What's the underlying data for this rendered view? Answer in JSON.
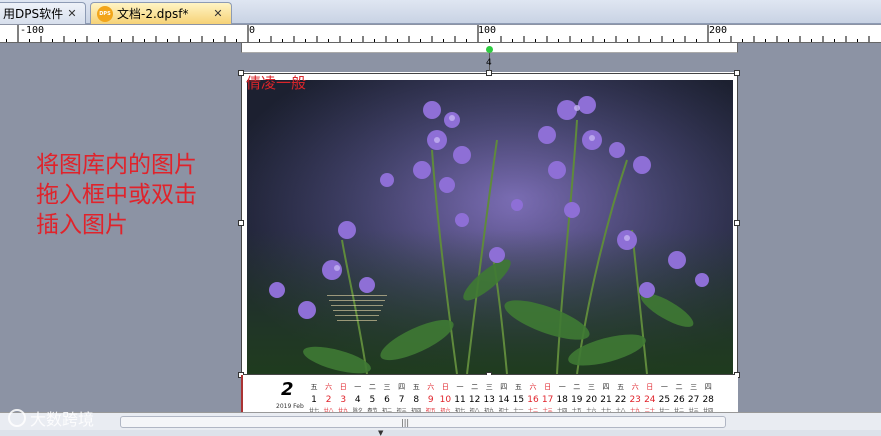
{
  "tabs": [
    {
      "label": "用DPS软件",
      "close": "✕",
      "active": false
    },
    {
      "label": "文档-2.dpsf*",
      "close": "✕",
      "active": true,
      "icon": "dps-doc-icon",
      "icon_text": "DPS"
    }
  ],
  "ruler": {
    "labels": [
      "-100",
      "0",
      "100",
      "200"
    ]
  },
  "rotation_label": "4",
  "canvas_text": "倩凌一般",
  "instruction_lines": [
    "将图库内的图片",
    "拖入框中或双击",
    "插入图片"
  ],
  "calendar": {
    "month": "2",
    "sub": "2019 Feb",
    "weekdays": [
      "五",
      "六",
      "日",
      "一",
      "二",
      "三",
      "四",
      "五",
      "六",
      "日",
      "一",
      "二",
      "三",
      "四",
      "五",
      "六",
      "日",
      "一",
      "二",
      "三",
      "四",
      "五",
      "六",
      "日",
      "一",
      "二",
      "三",
      "四"
    ],
    "days": [
      "1",
      "2",
      "3",
      "4",
      "5",
      "6",
      "7",
      "8",
      "9",
      "10",
      "11",
      "12",
      "13",
      "14",
      "15",
      "16",
      "17",
      "18",
      "19",
      "20",
      "21",
      "22",
      "23",
      "24",
      "25",
      "26",
      "27",
      "28"
    ],
    "lunar": [
      "廿七",
      "廿八",
      "廿九",
      "除夕",
      "春节",
      "初二",
      "初三",
      "初四",
      "初五",
      "初六",
      "初七",
      "初八",
      "初九",
      "初十",
      "十一",
      "十二",
      "十三",
      "十四",
      "十五",
      "十六",
      "十七",
      "十八",
      "十九",
      "二十",
      "廿一",
      "廿二",
      "廿三",
      "廿四"
    ],
    "weekend_color": "#e0232b"
  },
  "watermark": {
    "text": "大数跨境"
  },
  "scroll_grip": "|||",
  "colors": {
    "accent_tab": "#f6d277",
    "instruction": "#e0232b",
    "background": "#8c93a4"
  }
}
